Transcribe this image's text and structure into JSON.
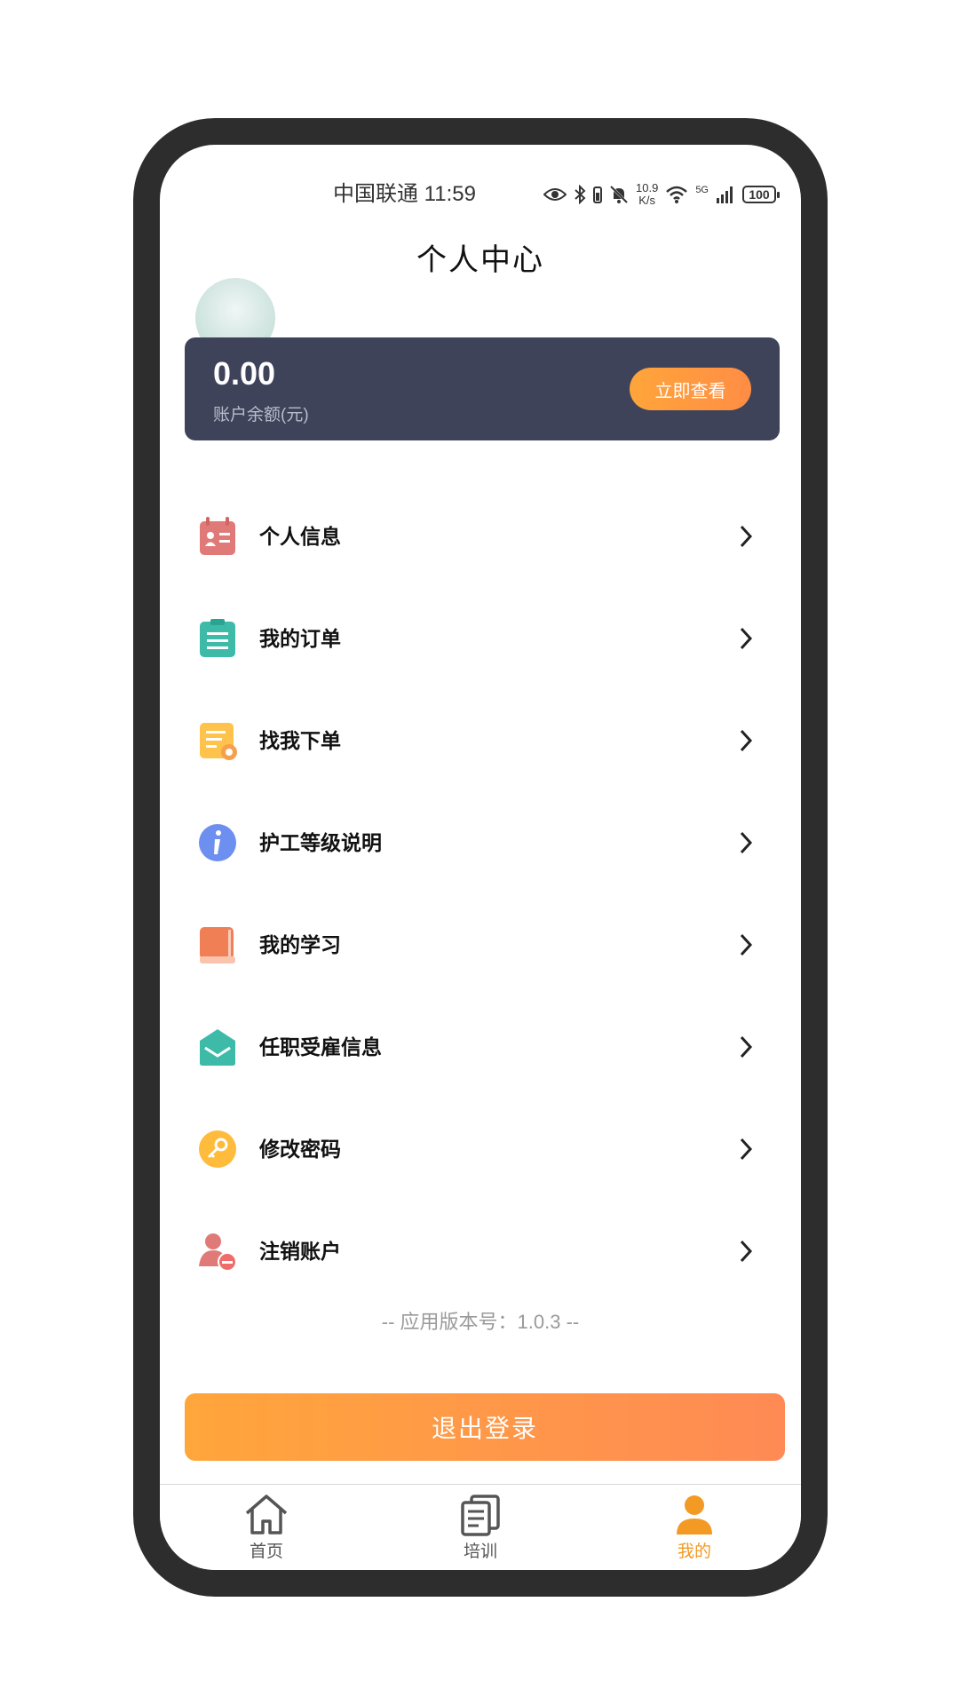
{
  "status_bar": {
    "carrier_time": "中国联通 11:59",
    "net_speed_value": "10.9",
    "net_speed_unit": "K/s",
    "network": "5G",
    "battery": "100"
  },
  "header": {
    "title": "个人中心"
  },
  "balance": {
    "amount": "0.00",
    "label": "账户余额(元)",
    "button": "立即查看"
  },
  "menu": [
    {
      "label": "个人信息",
      "icon": "id-card-icon"
    },
    {
      "label": "我的订单",
      "icon": "clipboard-icon"
    },
    {
      "label": "找我下单",
      "icon": "list-order-icon"
    },
    {
      "label": "护工等级说明",
      "icon": "info-icon"
    },
    {
      "label": "我的学习",
      "icon": "book-icon"
    },
    {
      "label": "任职受雇信息",
      "icon": "envelope-icon"
    },
    {
      "label": "修改密码",
      "icon": "key-icon"
    },
    {
      "label": "注销账户",
      "icon": "user-remove-icon"
    }
  ],
  "version": "-- 应用版本号：1.0.3 --",
  "logout_button": "退出登录",
  "tabbar": {
    "items": [
      {
        "label": "首页",
        "icon": "home-icon",
        "active": false
      },
      {
        "label": "培训",
        "icon": "documents-icon",
        "active": false
      },
      {
        "label": "我的",
        "icon": "user-icon",
        "active": true
      }
    ]
  },
  "colors": {
    "accent": "#ff9a3c",
    "card": "#3f435a",
    "active_tab": "#f29a24"
  }
}
